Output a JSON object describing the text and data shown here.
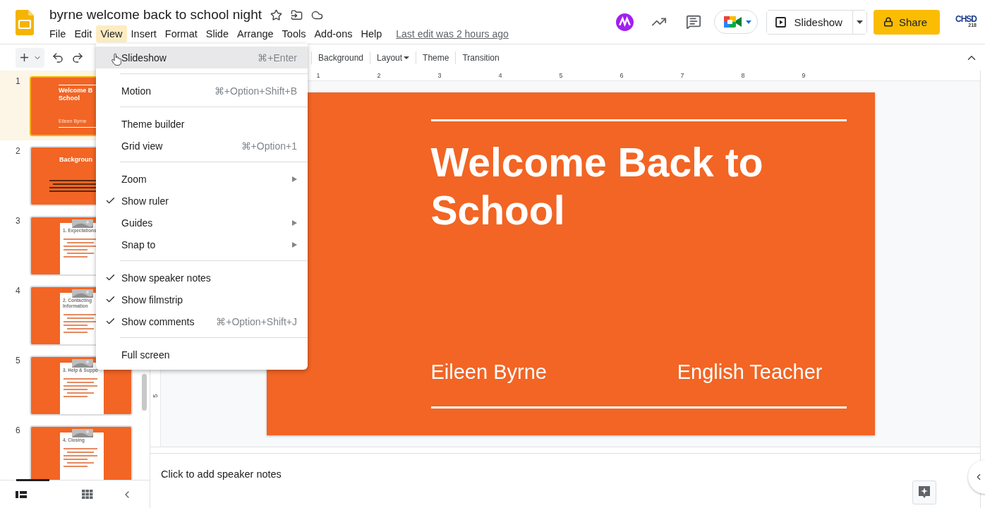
{
  "document": {
    "title": "byrne welcome back to school night"
  },
  "menu_bar": [
    {
      "label": "File",
      "selected": false
    },
    {
      "label": "Edit",
      "selected": false
    },
    {
      "label": "View",
      "selected": true
    },
    {
      "label": "Insert",
      "selected": false
    },
    {
      "label": "Format",
      "selected": false
    },
    {
      "label": "Slide",
      "selected": false
    },
    {
      "label": "Arrange",
      "selected": false
    },
    {
      "label": "Tools",
      "selected": false
    },
    {
      "label": "Add-ons",
      "selected": false
    },
    {
      "label": "Help",
      "selected": false
    }
  ],
  "last_edit": "Last edit was 2 hours ago",
  "header": {
    "slideshow": "Slideshow",
    "share": "Share",
    "account_logo": [
      "CHSD",
      "218"
    ]
  },
  "toolbar": [
    {
      "label": "Background",
      "kind": "button"
    },
    {
      "label": "Layout",
      "kind": "dropdown"
    },
    {
      "label": "Theme",
      "kind": "button"
    },
    {
      "label": "Transition",
      "kind": "button"
    }
  ],
  "ruler": {
    "horizontal": [
      "1",
      "2",
      "3",
      "4",
      "5",
      "6",
      "7",
      "8",
      "9"
    ],
    "vertical": [
      "5"
    ]
  },
  "filmstrip": [
    {
      "number": "1",
      "selected": true,
      "kind": "title",
      "title": [
        "Welcome B",
        "School"
      ],
      "subtitle": "Eileen Byrne"
    },
    {
      "number": "2",
      "selected": false,
      "kind": "section",
      "title": [
        "Backgroun"
      ]
    },
    {
      "number": "3",
      "selected": false,
      "kind": "card",
      "title": [
        "1. Expectations"
      ]
    },
    {
      "number": "4",
      "selected": false,
      "kind": "card",
      "title": [
        "2. Contacting",
        "Information"
      ]
    },
    {
      "number": "5",
      "selected": false,
      "kind": "card",
      "title": [
        "3. Help & Suppo"
      ]
    },
    {
      "number": "6",
      "selected": false,
      "kind": "card",
      "title": [
        "4. Closing"
      ]
    }
  ],
  "view_menu": [
    {
      "kind": "item",
      "label": "Slideshow",
      "shortcut": "⌘+Enter",
      "checked": false,
      "submenu": false,
      "selected": true
    },
    {
      "kind": "divider"
    },
    {
      "kind": "item",
      "label": "Motion",
      "shortcut": "⌘+Option+Shift+B",
      "checked": false,
      "submenu": false,
      "selected": false
    },
    {
      "kind": "divider"
    },
    {
      "kind": "item",
      "label": "Theme builder",
      "checked": false,
      "submenu": false,
      "selected": false
    },
    {
      "kind": "item",
      "label": "Grid view",
      "shortcut": "⌘+Option+1",
      "checked": false,
      "submenu": false,
      "selected": false
    },
    {
      "kind": "divider"
    },
    {
      "kind": "item",
      "label": "Zoom",
      "checked": false,
      "submenu": true,
      "selected": false
    },
    {
      "kind": "item",
      "label": "Show ruler",
      "checked": true,
      "submenu": false,
      "selected": false
    },
    {
      "kind": "item",
      "label": "Guides",
      "checked": false,
      "submenu": true,
      "selected": false
    },
    {
      "kind": "item",
      "label": "Snap to",
      "checked": false,
      "submenu": true,
      "selected": false
    },
    {
      "kind": "divider"
    },
    {
      "kind": "item",
      "label": "Show speaker notes",
      "checked": true,
      "submenu": false,
      "selected": false
    },
    {
      "kind": "item",
      "label": "Show filmstrip",
      "checked": true,
      "submenu": false,
      "selected": false
    },
    {
      "kind": "item",
      "label": "Show comments",
      "shortcut": "⌘+Option+Shift+J",
      "checked": true,
      "submenu": false,
      "selected": false
    },
    {
      "kind": "divider"
    },
    {
      "kind": "item",
      "label": "Full screen",
      "checked": false,
      "submenu": false,
      "selected": false
    }
  ],
  "slide": {
    "title": "Welcome Back to School",
    "name": "Eileen Byrne",
    "role": "English Teacher"
  },
  "notes": {
    "placeholder": "Click to add speaker notes"
  }
}
